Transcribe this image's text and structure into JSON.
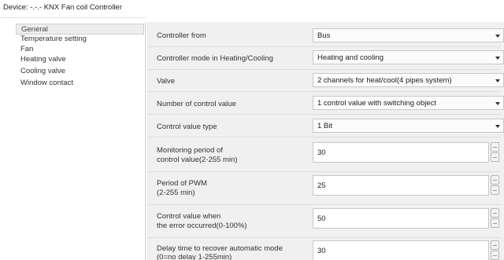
{
  "title": "Device: -.-.-  KNX Fan coil Controller",
  "sidebar": {
    "items": [
      {
        "label": "General",
        "active": true
      },
      {
        "label": "Temperature setting",
        "active": false
      },
      {
        "label": "Fan",
        "active": false
      },
      {
        "label": "Heating valve",
        "active": false
      },
      {
        "label": "Cooling valve",
        "active": false
      },
      {
        "label": "Window contact",
        "active": false
      }
    ]
  },
  "params": {
    "controller_from": {
      "label": "Controller from",
      "value": "Bus"
    },
    "controller_mode": {
      "label": "Controller mode in Heating/Cooling",
      "value": "Heating and cooling"
    },
    "valve": {
      "label": "Valve",
      "value": "2 channels for heat/cool(4 pipes system)"
    },
    "num_control_value": {
      "label": "Number of control value",
      "value": "1 control value with switching object"
    },
    "control_value_type": {
      "label": "Control value type",
      "value": "1 Bit"
    },
    "monitoring_period": {
      "label_line1": "Monitoring period of",
      "label_line2": "control value(2-255 min)",
      "value": "30"
    },
    "pwm_period": {
      "label_line1": "Period of PWM",
      "label_line2": "(2-255 min)",
      "value": "25"
    },
    "error_value": {
      "label_line1": "Control value when",
      "label_line2": "the error occurred(0-100%)",
      "value": "50"
    },
    "delay_time": {
      "label_line1": "Delay time to recover automatic mode",
      "label_line2": "(0=no delay 1-255min)",
      "value": "30"
    }
  }
}
